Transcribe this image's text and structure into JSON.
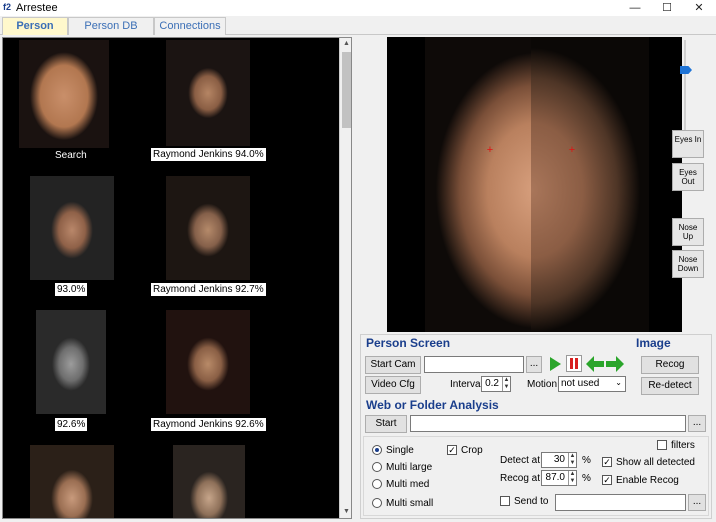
{
  "window": {
    "title": "Arrestee",
    "icon_text": "f2",
    "minimize": "—",
    "maximize": "☐",
    "close": "✕"
  },
  "tabs": [
    {
      "label": "Person"
    },
    {
      "label": "Person DB"
    },
    {
      "label": "Connections"
    }
  ],
  "gallery": {
    "captions": [
      "Search",
      "Raymond Jenkins 94.0%",
      "93.0%",
      "Raymond Jenkins 92.7%",
      "92.6%",
      "Raymond Jenkins 92.6%"
    ],
    "scroll_up": "▲",
    "scroll_down": "▼"
  },
  "viewer": {
    "eyes_in": "Eyes In",
    "eyes_out": "Eyes Out",
    "nose_up": "Nose Up",
    "nose_down": "Nose Down"
  },
  "person_screen": {
    "heading": "Person Screen",
    "start_cam": "Start Cam",
    "video_cfg": "Video Cfg",
    "browse": "...",
    "interval_label": "Interval",
    "interval_value": "0.2",
    "motion_label": "Motion",
    "motion_value": "not used",
    "play_icon": "play-icon",
    "pause_icon": "pause-icon",
    "prev_icon": "arrow-left-icon",
    "next_icon": "arrow-right-icon"
  },
  "image": {
    "heading": "Image",
    "recog": "Recog",
    "redetect": "Re-detect"
  },
  "web_folder": {
    "heading": "Web or Folder Analysis",
    "start": "Start",
    "browse": "...",
    "filters": "filters",
    "single": "Single",
    "multi_large": "Multi large",
    "multi_med": "Multi med",
    "multi_small": "Multi small",
    "crop": "Crop",
    "detect_at_label": "Detect at",
    "detect_at_value": "30",
    "recog_at_label": "Recog at",
    "recog_at_value": "87.0",
    "percent": "%",
    "show_all_detected": "Show all detected",
    "enable_recog": "Enable Recog",
    "send_to": "Send to",
    "send_browse": "..."
  },
  "colors": {
    "accent": "#1a3e8c",
    "tab_active": "#fff8cc",
    "play": "#2aa52a",
    "pause": "#d81f1f"
  }
}
